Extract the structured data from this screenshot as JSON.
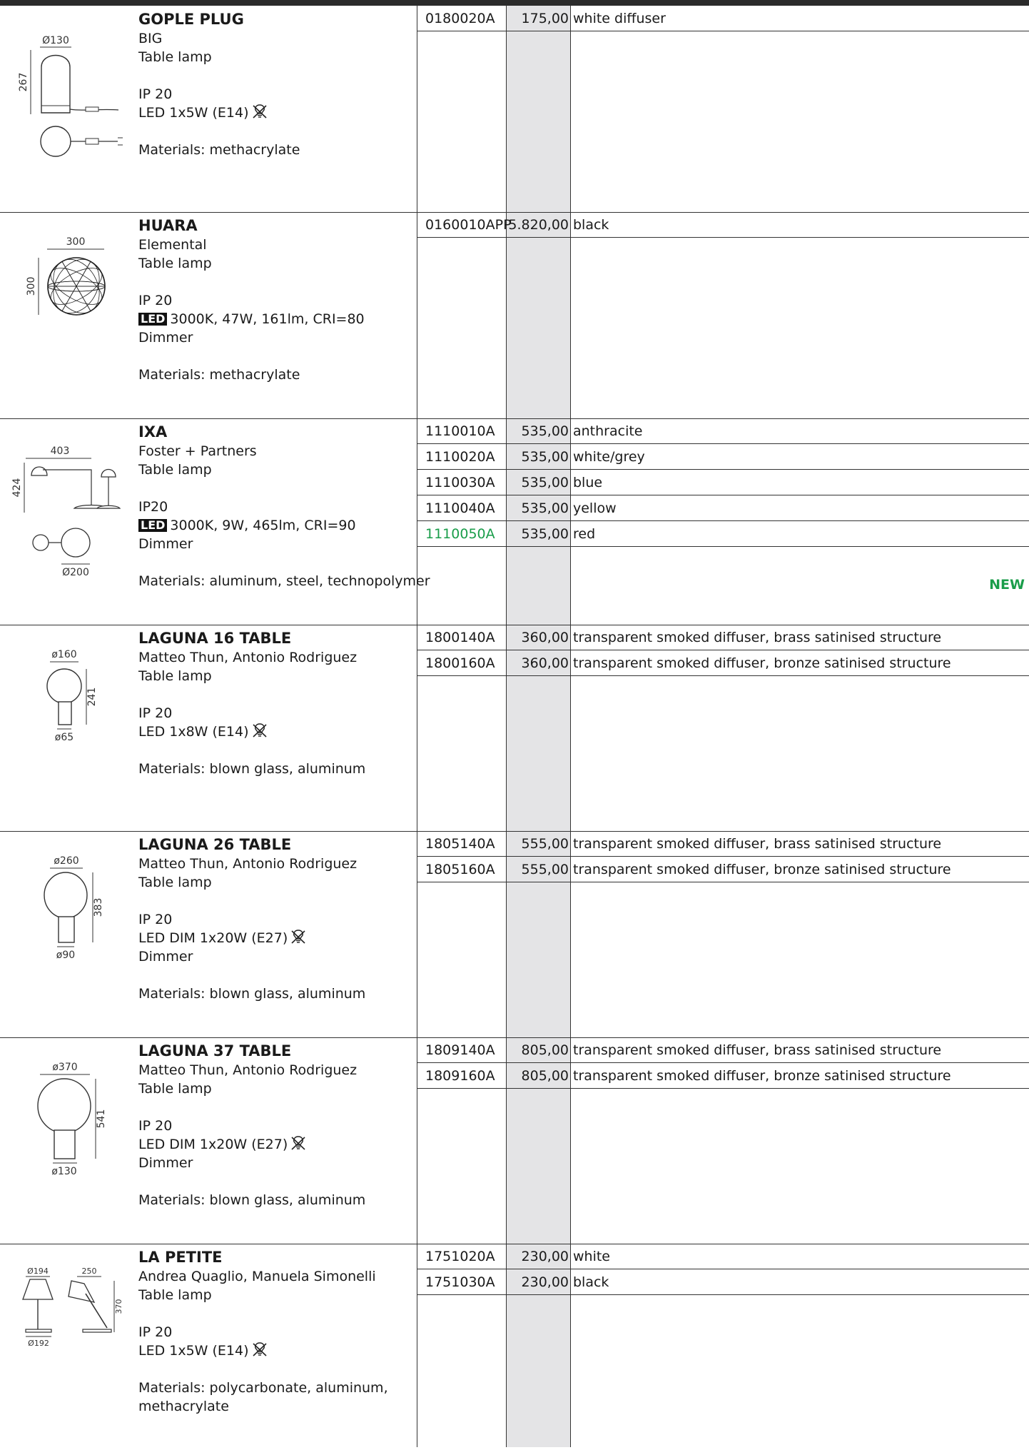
{
  "products": [
    {
      "name": "GOPLE PLUG",
      "subtitle": [
        "BIG",
        "Table lamp"
      ],
      "specs": [
        {
          "text": "IP 20"
        },
        {
          "text": "LED 1x5W (E14)",
          "bulb_icon": true
        }
      ],
      "materials": [
        "Materials: methacrylate"
      ],
      "dimensions": [
        "Ø130",
        "267"
      ],
      "rows": [
        {
          "code": "0180020A",
          "price": "175,00",
          "desc": "white diffuser"
        }
      ]
    },
    {
      "name": "HUARA",
      "subtitle": [
        "Elemental",
        "Table lamp"
      ],
      "specs": [
        {
          "text": "IP 20"
        },
        {
          "led_badge": "LED",
          "text": "3000K, 47W, 161lm, CRI=80"
        },
        {
          "text": "Dimmer"
        }
      ],
      "materials": [
        "Materials: methacrylate"
      ],
      "dimensions": [
        "300",
        "300"
      ],
      "rows": [
        {
          "code": "0160010APP",
          "price": "5.820,00",
          "desc": "black"
        }
      ]
    },
    {
      "name": "IXA",
      "subtitle": [
        "Foster + Partners",
        "Table lamp"
      ],
      "specs": [
        {
          "text": "IP20"
        },
        {
          "led_badge": "LED",
          "text": "3000K, 9W, 465lm, CRI=90"
        },
        {
          "text": "Dimmer"
        }
      ],
      "materials": [
        "Materials: aluminum, steel, technopolymer"
      ],
      "dimensions": [
        "403",
        "424",
        "Ø200"
      ],
      "rows": [
        {
          "code": "1110010A",
          "price": "535,00",
          "desc": "anthracite"
        },
        {
          "code": "1110020A",
          "price": "535,00",
          "desc": "white/grey"
        },
        {
          "code": "1110030A",
          "price": "535,00",
          "desc": "blue"
        },
        {
          "code": "1110040A",
          "price": "535,00",
          "desc": "yellow"
        },
        {
          "code": "1110050A",
          "price": "535,00",
          "desc": "red",
          "highlight": true
        }
      ],
      "badge": "NEW"
    },
    {
      "name": "LAGUNA 16 TABLE",
      "subtitle": [
        "Matteo Thun, Antonio Rodriguez",
        "Table lamp"
      ],
      "specs": [
        {
          "text": "IP 20"
        },
        {
          "text": "LED 1x8W (E14)",
          "bulb_icon": true
        }
      ],
      "materials": [
        "Materials: blown glass, aluminum"
      ],
      "dimensions": [
        "ø160",
        "241",
        "ø65"
      ],
      "rows": [
        {
          "code": "1800140A",
          "price": "360,00",
          "desc": "transparent smoked diffuser, brass satinised structure"
        },
        {
          "code": "1800160A",
          "price": "360,00",
          "desc": "transparent smoked diffuser, bronze satinised structure"
        }
      ]
    },
    {
      "name": "LAGUNA 26 TABLE",
      "subtitle": [
        "Matteo Thun, Antonio Rodriguez",
        "Table lamp"
      ],
      "specs": [
        {
          "text": "IP 20"
        },
        {
          "text": "LED DIM 1x20W (E27)",
          "bulb_icon": true
        },
        {
          "text": "Dimmer"
        }
      ],
      "materials": [
        "Materials: blown glass, aluminum"
      ],
      "dimensions": [
        "ø260",
        "383",
        "ø90"
      ],
      "rows": [
        {
          "code": "1805140A",
          "price": "555,00",
          "desc": "transparent smoked diffuser, brass satinised structure"
        },
        {
          "code": "1805160A",
          "price": "555,00",
          "desc": "transparent smoked diffuser, bronze satinised structure"
        }
      ]
    },
    {
      "name": "LAGUNA 37 TABLE",
      "subtitle": [
        "Matteo Thun, Antonio Rodriguez",
        "Table lamp"
      ],
      "specs": [
        {
          "text": "IP 20"
        },
        {
          "text": "LED DIM 1x20W (E27)",
          "bulb_icon": true
        },
        {
          "text": "Dimmer"
        }
      ],
      "materials": [
        "Materials: blown glass, aluminum"
      ],
      "dimensions": [
        "ø370",
        "541",
        "ø130"
      ],
      "rows": [
        {
          "code": "1809140A",
          "price": "805,00",
          "desc": "transparent smoked diffuser, brass satinised structure"
        },
        {
          "code": "1809160A",
          "price": "805,00",
          "desc": "transparent smoked diffuser, bronze satinised structure"
        }
      ]
    },
    {
      "name": "LA PETITE",
      "subtitle": [
        "Andrea Quaglio, Manuela Simonelli",
        "Table lamp"
      ],
      "specs": [
        {
          "text": "IP 20"
        },
        {
          "text": "LED 1x5W (E14)",
          "bulb_icon": true
        }
      ],
      "materials": [
        "Materials: polycarbonate, aluminum,",
        "methacrylate"
      ],
      "dimensions": [
        "Ø194",
        "250",
        "370",
        "Ø192"
      ],
      "rows": [
        {
          "code": "1751020A",
          "price": "230,00",
          "desc": "white"
        },
        {
          "code": "1751030A",
          "price": "230,00",
          "desc": "black"
        }
      ]
    }
  ],
  "colors": {
    "new_badge": "#1a9d4a",
    "price_column_bg": "#e4e4e6",
    "top_bar": "#2b2b2b"
  }
}
